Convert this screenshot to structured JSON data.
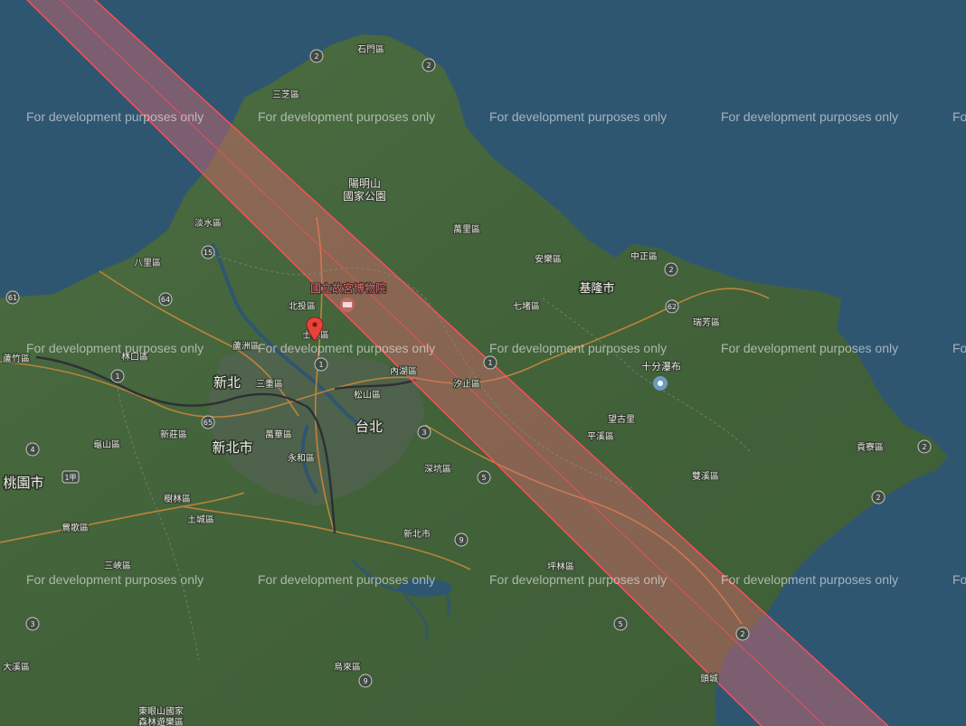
{
  "watermark": "For development purposes only",
  "watermark_edge": "Fo",
  "labels": {
    "shimen": "石門區",
    "sanzhi": "三芝區",
    "yangmingshan_1": "陽明山",
    "yangmingshan_2": "國家公園",
    "tamsui": "淡水區",
    "bali": "八里區",
    "beitou": "北投區",
    "shilin": "士林區",
    "palace_museum": "國立故宮博物院",
    "luzhou": "蘆洲區",
    "linkou": "林口區",
    "luzhu": "蘆竹區",
    "sanchong": "三重區",
    "songshan": "松山區",
    "neihu": "內湖區",
    "xizhi": "汐止區",
    "wanli": "萬里區",
    "anle": "安樂區",
    "qidu": "七堵區",
    "keelung": "基隆市",
    "zhongzheng": "中正區",
    "ruifang": "瑞芳區",
    "shifen": "十分瀑布",
    "taipei": "台北",
    "xinbei_top": "新北",
    "xinbei_city": "新北市",
    "xinzhuang": "新莊區",
    "wanhua": "萬華區",
    "yonghe": "永和區",
    "shenkeng": "深坑區",
    "pingxi": "平溪區",
    "wanggu": "望古里",
    "shuangxi": "雙溪區",
    "gongliao": "貢寮區",
    "guishan": "龜山區",
    "taoyuan": "桃園市",
    "shulin": "樹林區",
    "yingge": "鶯歌區",
    "tucheng": "土城區",
    "sanxia": "三峽區",
    "pinglin": "坪林區",
    "daxi": "大溪區",
    "wulai": "烏來區",
    "dongyan_1": "東眼山國家",
    "dongyan_2": "森林遊樂區",
    "toucheng": "頭城",
    "xinbei_road": "新北市"
  },
  "route_shields": [
    "2",
    "2",
    "15",
    "64",
    "61",
    "1",
    "1",
    "1",
    "3",
    "5",
    "5",
    "62",
    "2",
    "2",
    "2",
    "9",
    "9",
    "3",
    "4",
    "1甲",
    "65",
    "2"
  ],
  "marker": {
    "name": "location-pin"
  },
  "colors": {
    "sea": "#2f5671",
    "land": "#45663c",
    "corridor_fill": "#e86a72",
    "corridor_stroke": "#ff4d55",
    "marker": "#e8433b"
  }
}
